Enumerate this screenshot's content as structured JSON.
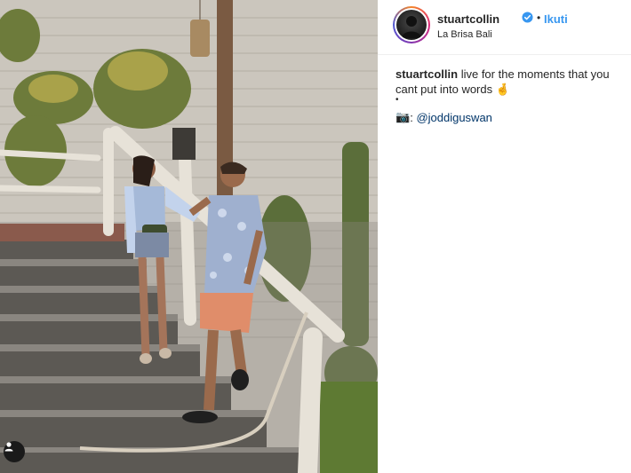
{
  "post": {
    "image": {
      "description_icon": "user-tag-icon",
      "colors": {
        "wall": "#c9c4bb",
        "stairs": "#5f5c57",
        "rail": "#e7e2d8",
        "plants": "#6d7b3b"
      }
    },
    "header": {
      "username": "stuartcollin",
      "verified_icon": "verified-badge-icon",
      "dot": "•",
      "follow_label": "Ikuti",
      "location": "La Brisa Bali"
    },
    "caption": {
      "username": "stuartcollin",
      "text": "live for the moments that you cant put into words",
      "emoji": "🤞",
      "bullet": "•",
      "camera_emoji": "📷",
      "credit_separator": ":",
      "credit_mention": "@joddiguswan"
    },
    "colors": {
      "accent": "#3897f0",
      "mention": "#003569",
      "text": "#262626"
    }
  }
}
